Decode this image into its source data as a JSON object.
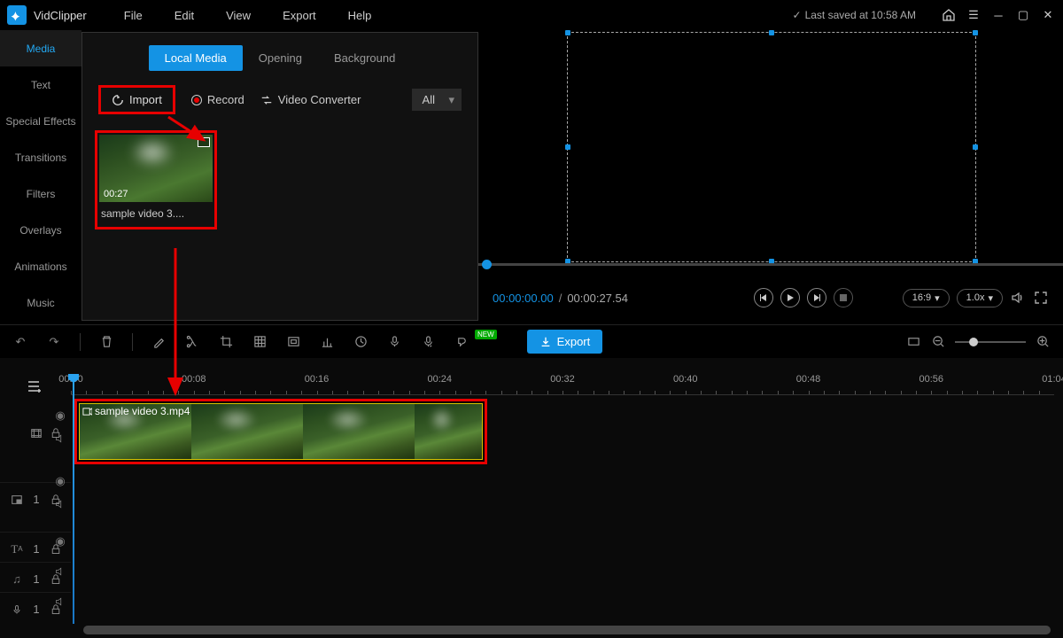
{
  "app": {
    "name": "VidClipper",
    "saveStatus": "Last saved at 10:58 AM"
  },
  "menu": [
    "File",
    "Edit",
    "View",
    "Export",
    "Help"
  ],
  "sidebar": [
    "Media",
    "Text",
    "Special Effects",
    "Transitions",
    "Filters",
    "Overlays",
    "Animations",
    "Music"
  ],
  "mediaTabs": [
    "Local Media",
    "Opening",
    "Background"
  ],
  "toolbar": {
    "import": "Import",
    "record": "Record",
    "converter": "Video Converter",
    "filter": "All"
  },
  "thumb": {
    "duration": "00:27",
    "name": "sample video 3...."
  },
  "preview": {
    "cur": "00:00:00.00",
    "tot": "00:00:27.54",
    "ratio": "16:9",
    "speed": "1.0x"
  },
  "export": "Export",
  "newBadge": "NEW",
  "ruler": [
    "00:00",
    "00:08",
    "00:16",
    "00:24",
    "00:32",
    "00:40",
    "00:48",
    "00:56",
    "01:04"
  ],
  "clip": {
    "label": "sample video 3.mp4"
  },
  "trackNums": {
    "pip": "1",
    "text": "1",
    "audio": "1",
    "voice": "1"
  }
}
